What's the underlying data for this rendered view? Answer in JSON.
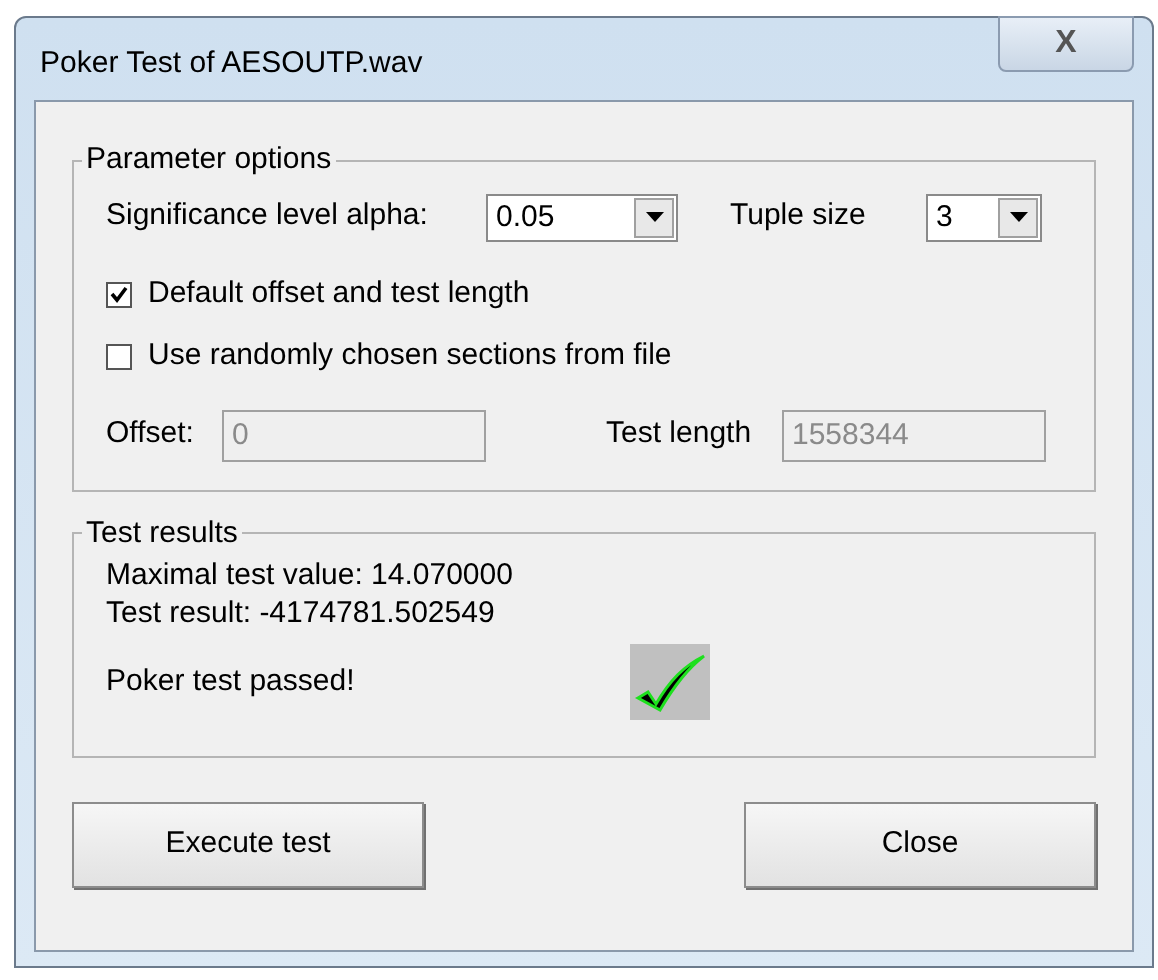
{
  "window": {
    "title": "Poker Test of AESOUTP.wav",
    "close_label": "X"
  },
  "parameter_options": {
    "title": "Parameter options",
    "alpha": {
      "label": "Significance level alpha:",
      "value": "0.05"
    },
    "tuple": {
      "label": "Tuple size",
      "value": "3"
    },
    "checkboxes": [
      {
        "label": "Default offset and test length",
        "checked": true
      },
      {
        "label": "Use randomly chosen sections from file",
        "checked": false
      }
    ],
    "offset": {
      "label": "Offset:",
      "value": "0",
      "disabled": true
    },
    "test_length": {
      "label": "Test length",
      "value": "1558344",
      "disabled": true
    }
  },
  "test_results": {
    "title": "Test results",
    "lines": [
      "Maximal test value: 14.070000",
      "Test result: -4174781.502549"
    ],
    "verdict": "Poker test passed!",
    "passed": true
  },
  "buttons": [
    "Execute test",
    "Close"
  ]
}
